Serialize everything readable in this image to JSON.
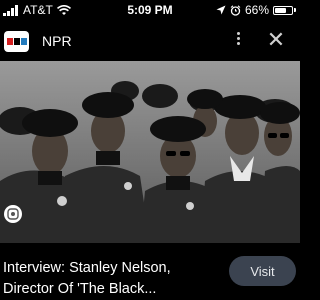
{
  "status_bar": {
    "carrier": "AT&T",
    "time": "5:09 PM",
    "battery_text": "66%",
    "battery_level": 0.66,
    "icons": [
      "signal-bars-icon",
      "wifi-icon",
      "location-arrow-icon",
      "alarm-clock-icon",
      "battery-icon"
    ]
  },
  "header": {
    "source_name": "NPR",
    "logo_colors": [
      "#d62021",
      "#000000",
      "#237bbd"
    ],
    "more_icon": "kebab-menu-icon",
    "close_icon": "close-icon",
    "close_glyph": "✕"
  },
  "image": {
    "lens_icon": "google-lens-icon"
  },
  "result": {
    "headline_line1": "Interview: Stanley Nelson,",
    "headline_line2": "Director Of 'The Black...",
    "visit_label": "Visit",
    "visit_bg": "#3b4350"
  }
}
